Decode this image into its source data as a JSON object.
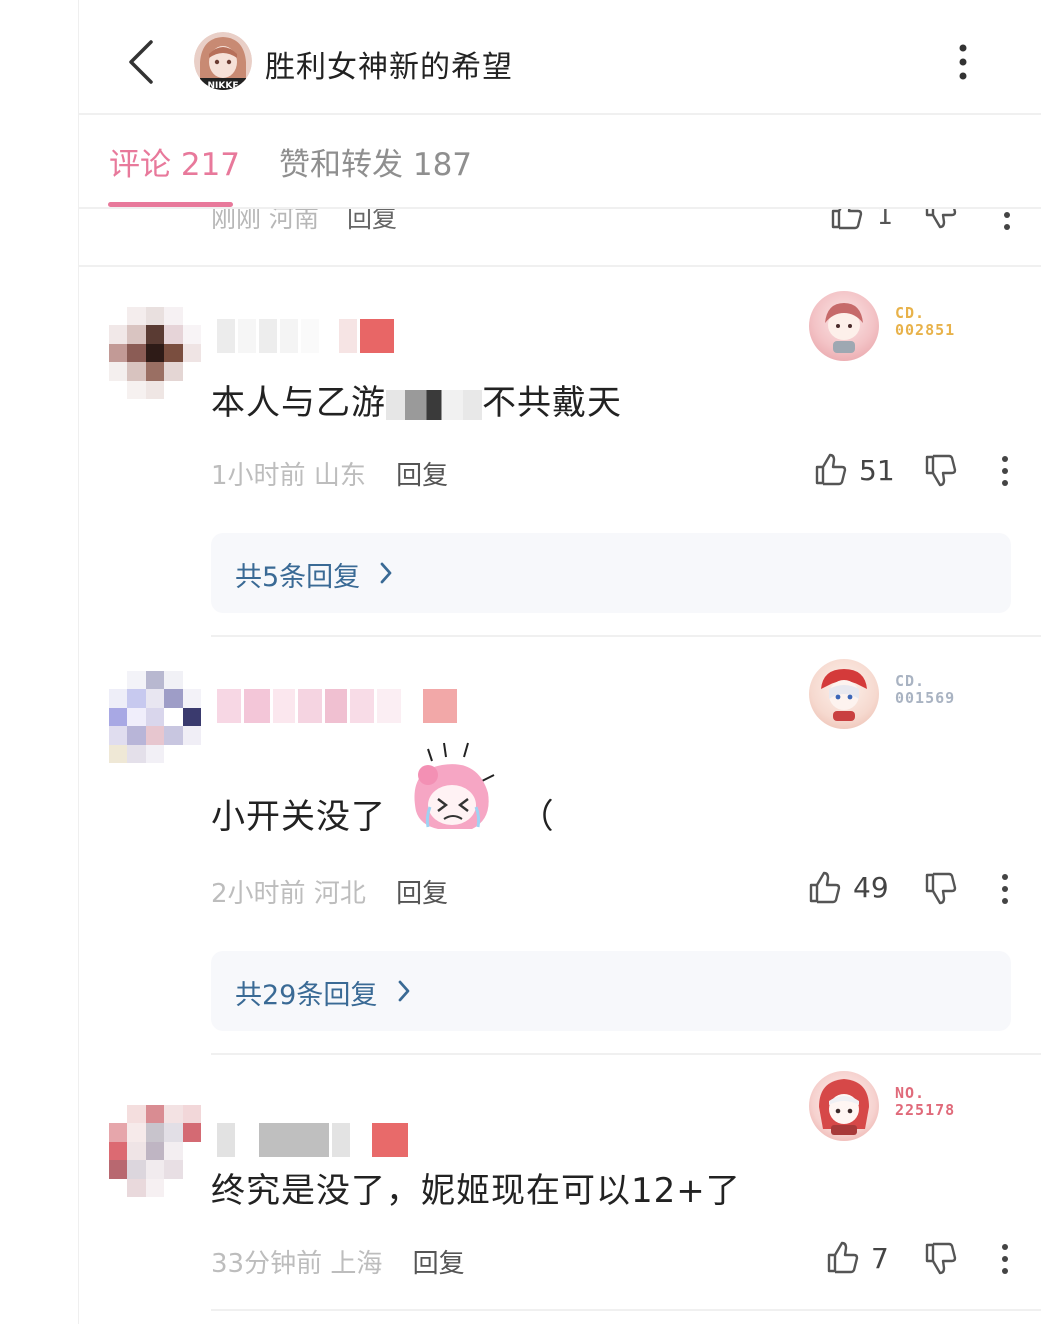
{
  "header": {
    "title": "胜利女神新的希望",
    "avatar_label": "NIKKE"
  },
  "tabs": [
    {
      "label": "评论 217"
    },
    {
      "label": "赞和转发 187"
    }
  ],
  "partial_comment": {
    "time": "刚刚",
    "location": "河南",
    "reply_label": "回复",
    "like_count": "1"
  },
  "comments": [
    {
      "text_before": "本人与乙游",
      "text_after": "不共戴天",
      "time": "1小时前",
      "location": "山东",
      "reply_label": "回复",
      "like_count": "51",
      "replies_label": "共5条回复",
      "badge_code_line1": "CD.",
      "badge_code_line2": "002851",
      "badge_color": "#e8b24a"
    },
    {
      "text_before": "小开关没了",
      "text_after": "（",
      "time": "2小时前",
      "location": "河北",
      "reply_label": "回复",
      "like_count": "49",
      "replies_label": "共29条回复",
      "badge_code_line1": "CD.",
      "badge_code_line2": "001569",
      "badge_color": "#a9b3c2"
    },
    {
      "text": "终究是没了，妮姬现在可以12+了",
      "time": "33分钟前",
      "location": "上海",
      "reply_label": "回复",
      "like_count": "7",
      "badge_code_line1": "NO.",
      "badge_code_line2": "225178",
      "badge_color": "#e06a7a"
    }
  ]
}
